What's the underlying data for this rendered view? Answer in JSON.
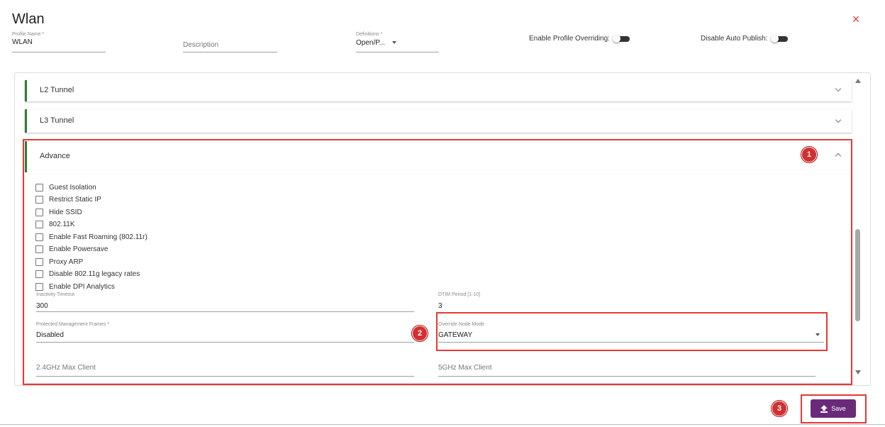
{
  "header": {
    "title": "Wlan",
    "close_icon": "×",
    "profile_name": {
      "label": "Profile Name *",
      "value": "WLAN"
    },
    "description": {
      "placeholder": "Description"
    },
    "definitions": {
      "label": "Definitions *",
      "value": "Open/P..."
    },
    "enable_profile_overriding": {
      "label": "Enable Profile Overriding:",
      "on": false
    },
    "disable_auto_publish": {
      "label": "Disable Auto Publish:",
      "on": false
    }
  },
  "sections": {
    "l2_tunnel": {
      "title": "L2 Tunnel",
      "expanded": false
    },
    "l3_tunnel": {
      "title": "L3 Tunnel",
      "expanded": false
    },
    "advance": {
      "title": "Advance",
      "expanded": true
    }
  },
  "advance": {
    "checkboxes": [
      {
        "label": "Guest Isolation",
        "checked": false
      },
      {
        "label": "Restrict Static IP",
        "checked": false
      },
      {
        "label": "Hide SSID",
        "checked": false
      },
      {
        "label": "802.11K",
        "checked": false
      },
      {
        "label": "Enable Fast Roaming (802.11r)",
        "checked": false
      },
      {
        "label": "Enable Powersave",
        "checked": false
      },
      {
        "label": "Proxy ARP",
        "checked": false
      },
      {
        "label": "Disable 802.11g legacy rates",
        "checked": false
      },
      {
        "label": "Enable DPI Analytics",
        "checked": false
      }
    ],
    "inactivity_timeout": {
      "label": "Inactivity Timeout",
      "value": "300"
    },
    "dtim_period": {
      "label": "DTIM Period [1-10]",
      "value": "3"
    },
    "protected_management_frames": {
      "label": "Protected Management Frames *",
      "value": "Disabled"
    },
    "override_node_mode": {
      "label": "Override Node Mode",
      "value": "GATEWAY"
    },
    "max_client_24": {
      "placeholder": "2.4GHz Max Client"
    },
    "max_client_5": {
      "placeholder": "5GHz Max Client"
    }
  },
  "annotations": {
    "badge1": "1",
    "badge2": "2",
    "badge3": "3",
    "color": "#e53935"
  },
  "footer": {
    "save_label": "Save",
    "save_color": "#6a2a7a"
  },
  "colors": {
    "accent_green": "#2e7d32",
    "close_red": "#e53935"
  }
}
